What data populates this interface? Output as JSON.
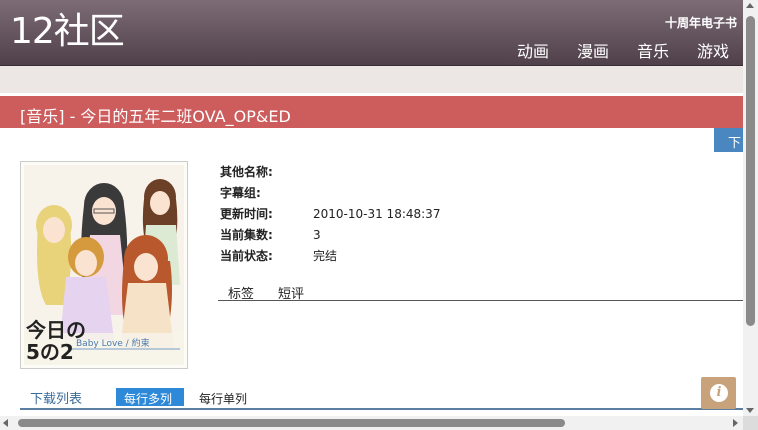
{
  "header": {
    "logo": "12社区",
    "ebook_link": "十周年电子书",
    "nav": [
      "动画",
      "漫画",
      "音乐",
      "游戏"
    ]
  },
  "page_title": "[音乐] - 今日的五年二班OVA_OP&ED",
  "download_tab_label": "下",
  "cover": {
    "logo_text": "今日の5の2",
    "caption": "Baby Love / 約束"
  },
  "meta": [
    {
      "key": "其他名称:",
      "value": ""
    },
    {
      "key": "字幕组:",
      "value": ""
    },
    {
      "key": "更新时间:",
      "value": "2010-10-31 18:48:37"
    },
    {
      "key": "当前集数:",
      "value": "3"
    },
    {
      "key": "当前状态:",
      "value": "完结"
    }
  ],
  "tabs": [
    "标签",
    "短评"
  ],
  "download_list": {
    "title": "下载列表",
    "view_multi": "每行多列",
    "view_single": "每行单列"
  },
  "info_button": "i",
  "colors": {
    "header_bg": "#6b5a64",
    "title_bar": "#cd5c5c",
    "accent_blue": "#2e8ad8",
    "info_button": "#c8a27a"
  }
}
